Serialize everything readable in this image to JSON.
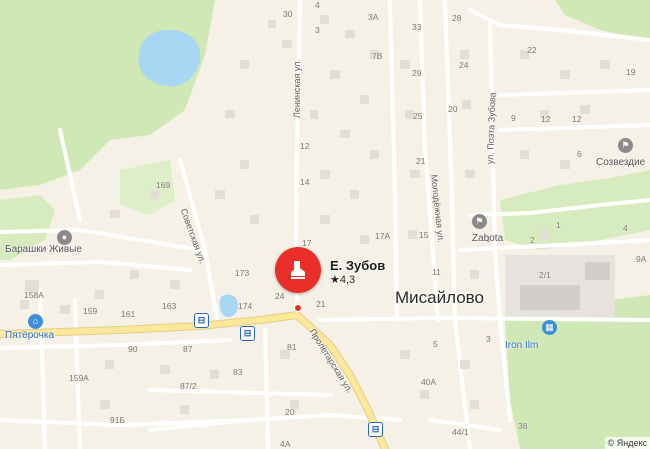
{
  "colors": {
    "background": "#f6f1e7",
    "forest": "#cfe8b5",
    "water": "#a7d7f3",
    "road": "#ffffff",
    "main_road": "#fde79a",
    "pin": "#ea2f2a",
    "bus_stop": "#2367c9",
    "shop_icon": "#3b8fd9",
    "poi_gray": "#8a8a8a"
  },
  "place": {
    "name": "Е. Зубов",
    "rating": "4,3",
    "icon": "shoe-store-icon"
  },
  "town_label": "Мисайлово",
  "streets": {
    "leninskaya": "Ленинская ул.",
    "sovetskaya": "Советская ул.",
    "proletarskaya": "Пролетарская ул.",
    "molodezhnaya": "Молодёжная ул.",
    "poeta_zubova": "ул. Поэта Зубова"
  },
  "pois": {
    "barashki": "Барашки Живые",
    "pyaterochka": "Пятёрочка",
    "zabota": "Zabota",
    "sozvezdie": "Созвездие",
    "iron": "Iron Ilm"
  },
  "building_numbers": [
    "30",
    "3",
    "3А",
    "28",
    "4",
    "33",
    "22",
    "7В",
    "29",
    "24",
    "19",
    "20",
    "12",
    "25",
    "9",
    "12",
    "6",
    "21",
    "12",
    "14",
    "17",
    "169",
    "17А",
    "15",
    "11",
    "1",
    "2",
    "4",
    "173",
    "24",
    "21",
    "158А",
    "174",
    "159",
    "161",
    "163",
    "9А",
    "90",
    "87",
    "1",
    "2/1",
    "3",
    "5",
    "83",
    "81",
    "159А",
    "87/2",
    "40А",
    "91Б",
    "20",
    "38",
    "4А",
    "44/1"
  ],
  "copyright": "© Яндекс"
}
